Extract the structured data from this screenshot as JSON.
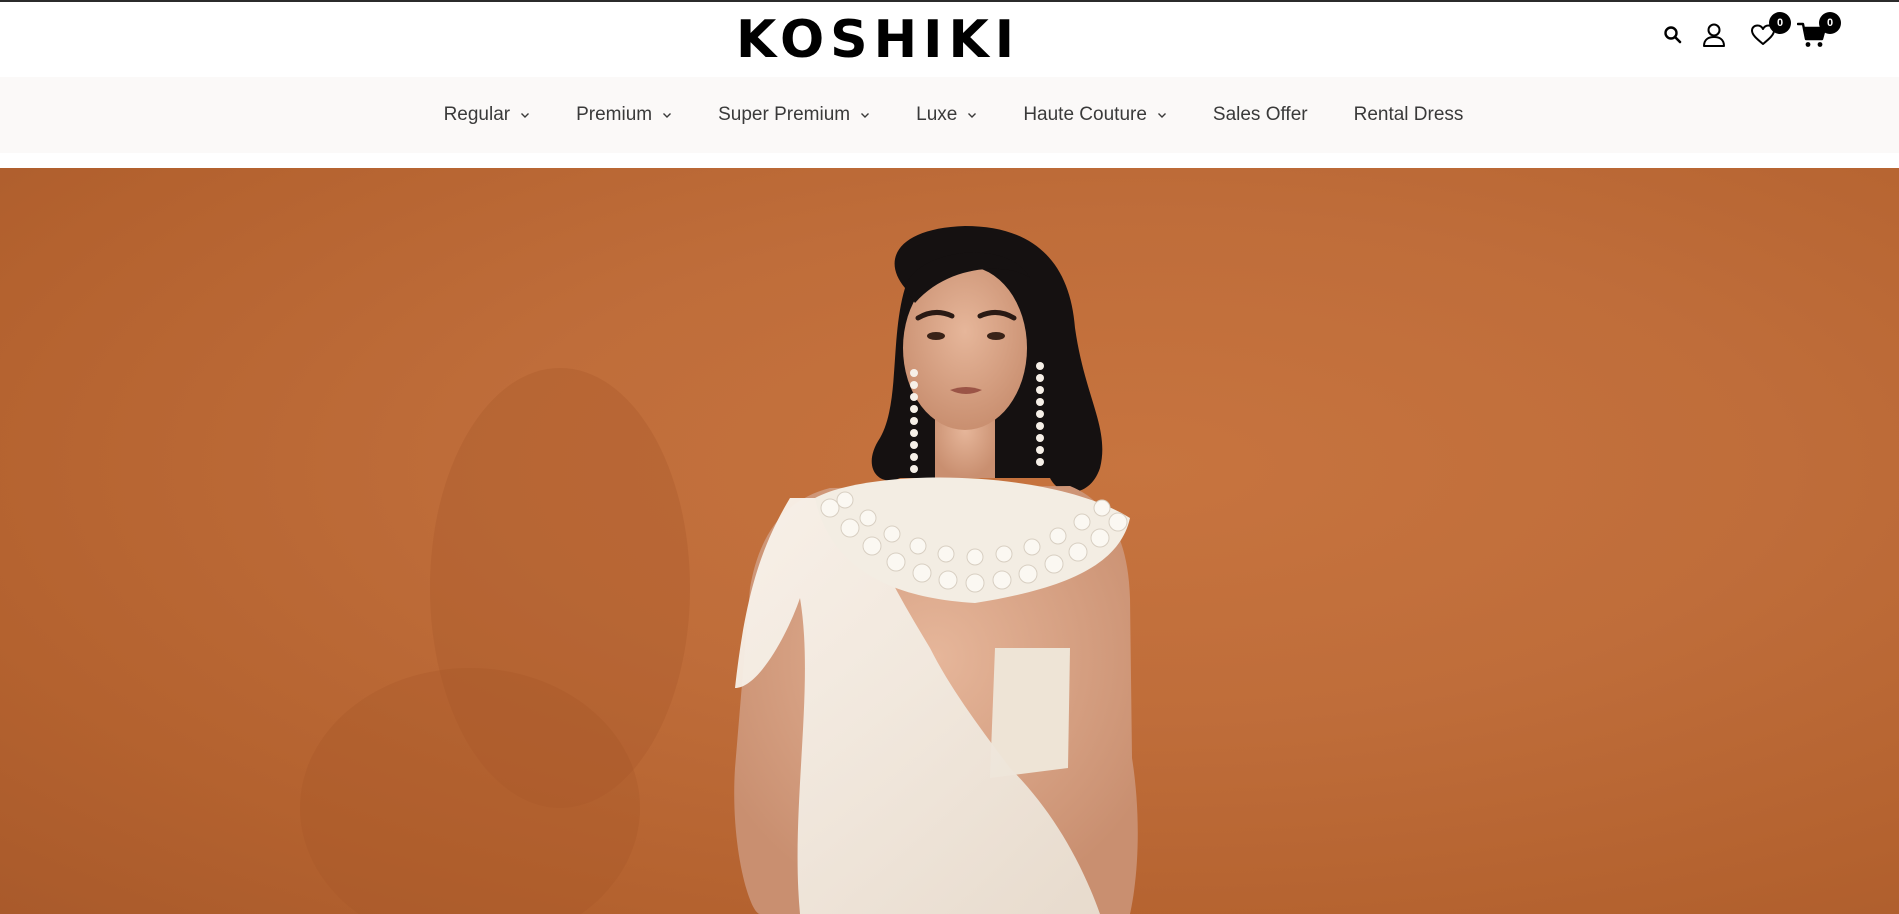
{
  "brand": {
    "logo_text": "KOSHIKI"
  },
  "header": {
    "icons": [
      "search-icon",
      "account-icon",
      "wishlist-icon",
      "cart-icon"
    ],
    "wishlist_count": "0",
    "cart_count": "0"
  },
  "nav": {
    "items": [
      {
        "label": "Regular",
        "has_dropdown": true
      },
      {
        "label": "Premium",
        "has_dropdown": true
      },
      {
        "label": "Super Premium",
        "has_dropdown": true
      },
      {
        "label": "Luxe",
        "has_dropdown": true
      },
      {
        "label": "Haute Couture",
        "has_dropdown": true
      },
      {
        "label": "Sales Offer",
        "has_dropdown": false
      },
      {
        "label": "Rental Dress",
        "has_dropdown": false
      }
    ]
  },
  "hero": {
    "background_color": "#bf6d3a",
    "garment_color": "#f4ece2"
  }
}
